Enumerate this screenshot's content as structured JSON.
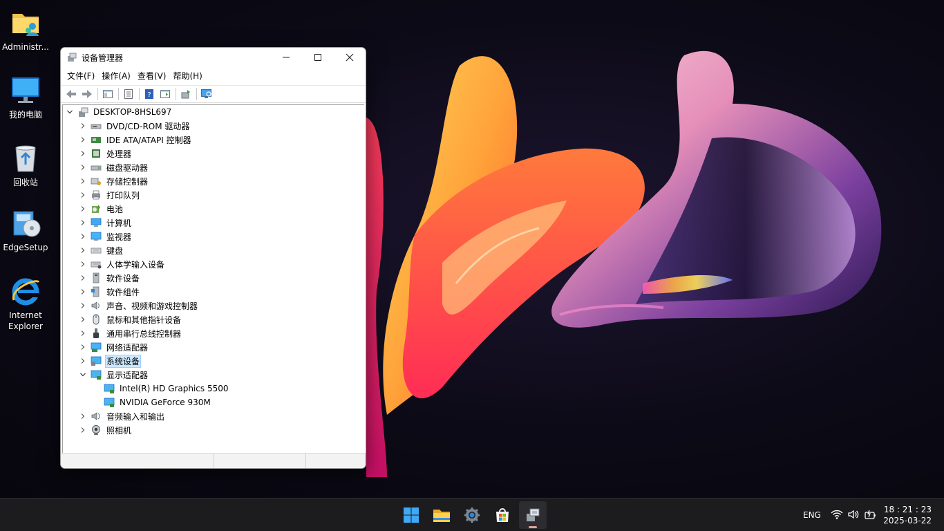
{
  "desktop": {
    "icons": [
      {
        "label": "Administr..."
      },
      {
        "label": "我的电脑"
      },
      {
        "label": "回收站"
      },
      {
        "label": "EdgeSetup"
      },
      {
        "label": "Internet Explorer"
      }
    ]
  },
  "window": {
    "title": "设备管理器",
    "menus": [
      "文件(F)",
      "操作(A)",
      "查看(V)",
      "帮助(H)"
    ],
    "root": "DESKTOP-8HSL697",
    "items": [
      {
        "label": "DVD/CD-ROM 驱动器",
        "icon": "dvd-drive-icon"
      },
      {
        "label": "IDE ATA/ATAPI 控制器",
        "icon": "ide-controller-icon"
      },
      {
        "label": "处理器",
        "icon": "processor-icon"
      },
      {
        "label": "磁盘驱动器",
        "icon": "disk-drive-icon"
      },
      {
        "label": "存储控制器",
        "icon": "storage-controller-icon"
      },
      {
        "label": "打印队列",
        "icon": "printer-icon"
      },
      {
        "label": "电池",
        "icon": "battery-icon"
      },
      {
        "label": "计算机",
        "icon": "computer-icon"
      },
      {
        "label": "监视器",
        "icon": "monitor-icon"
      },
      {
        "label": "键盘",
        "icon": "keyboard-icon"
      },
      {
        "label": "人体学输入设备",
        "icon": "hid-icon"
      },
      {
        "label": "软件设备",
        "icon": "software-device-icon"
      },
      {
        "label": "软件组件",
        "icon": "software-component-icon"
      },
      {
        "label": "声音、视频和游戏控制器",
        "icon": "sound-icon"
      },
      {
        "label": "鼠标和其他指针设备",
        "icon": "mouse-icon"
      },
      {
        "label": "通用串行总线控制器",
        "icon": "usb-icon"
      },
      {
        "label": "网络适配器",
        "icon": "network-adapter-icon"
      },
      {
        "label": "系统设备",
        "icon": "system-device-icon",
        "selected": true
      },
      {
        "label": "显示适配器",
        "icon": "display-adapter-icon",
        "expanded": true,
        "children": [
          "Intel(R) HD Graphics 5500",
          "NVIDIA GeForce 930M"
        ]
      },
      {
        "label": "音频输入和输出",
        "icon": "audio-io-icon"
      },
      {
        "label": "照相机",
        "icon": "camera-icon"
      }
    ]
  },
  "taskbar": {
    "apps": [
      "start-icon",
      "file-explorer-icon",
      "settings-icon",
      "store-icon",
      "device-manager-icon"
    ],
    "language": "ENG",
    "time": "18 : 21 : 23",
    "date": "2025-03-22"
  },
  "colors": {
    "selection": "#cce8ff",
    "taskbar": "#1c1c1f"
  }
}
